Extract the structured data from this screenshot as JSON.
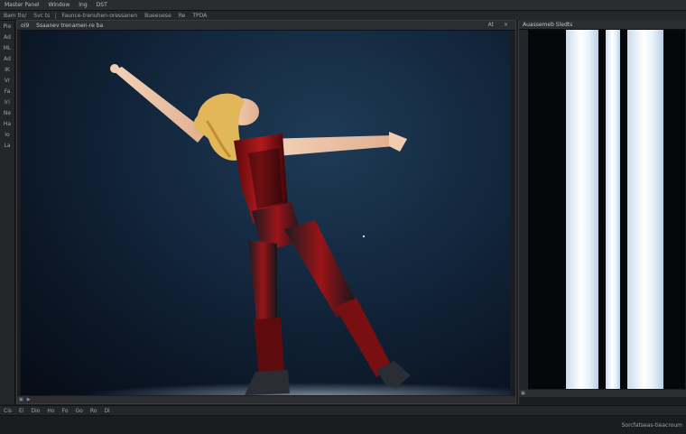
{
  "menubar": {
    "items": [
      "Master Panel",
      "Window",
      "Ing",
      "DST"
    ]
  },
  "optionsbar": {
    "items": [
      "Bam tlo/",
      "Svc ts",
      "Faunce-trenuhen-oressanen",
      "Bueeuese",
      "Re",
      "TPDA"
    ]
  },
  "toolbar": {
    "labels": [
      "Pie",
      "Ad",
      "ML",
      "Ad",
      "IK",
      "Vr",
      "Fa",
      "Iri",
      "Ne",
      "Ha",
      "Io",
      "La"
    ]
  },
  "document": {
    "tab_label": "oi9",
    "tab_title": "Ssaanev trenamen-re ba",
    "ctrl_right": "At",
    "close_glyph": "×"
  },
  "right_panel": {
    "tab_title": "Auassemeb Sledts"
  },
  "bottom": {
    "items": [
      "Cis",
      "Ei",
      "Dio",
      "Ho",
      "Fo",
      "Go",
      "Ro",
      "Di"
    ]
  },
  "status": {
    "right_text": "Sorcfatseas-tieacroum"
  },
  "colors": {
    "ui_bg": "#1c1e21",
    "canvas_bg": "#13273d",
    "suit_red": "#8b1216",
    "hair_gold": "#e2b75a"
  },
  "icons": [
    "close-icon",
    "window-icon",
    "play-icon"
  ]
}
